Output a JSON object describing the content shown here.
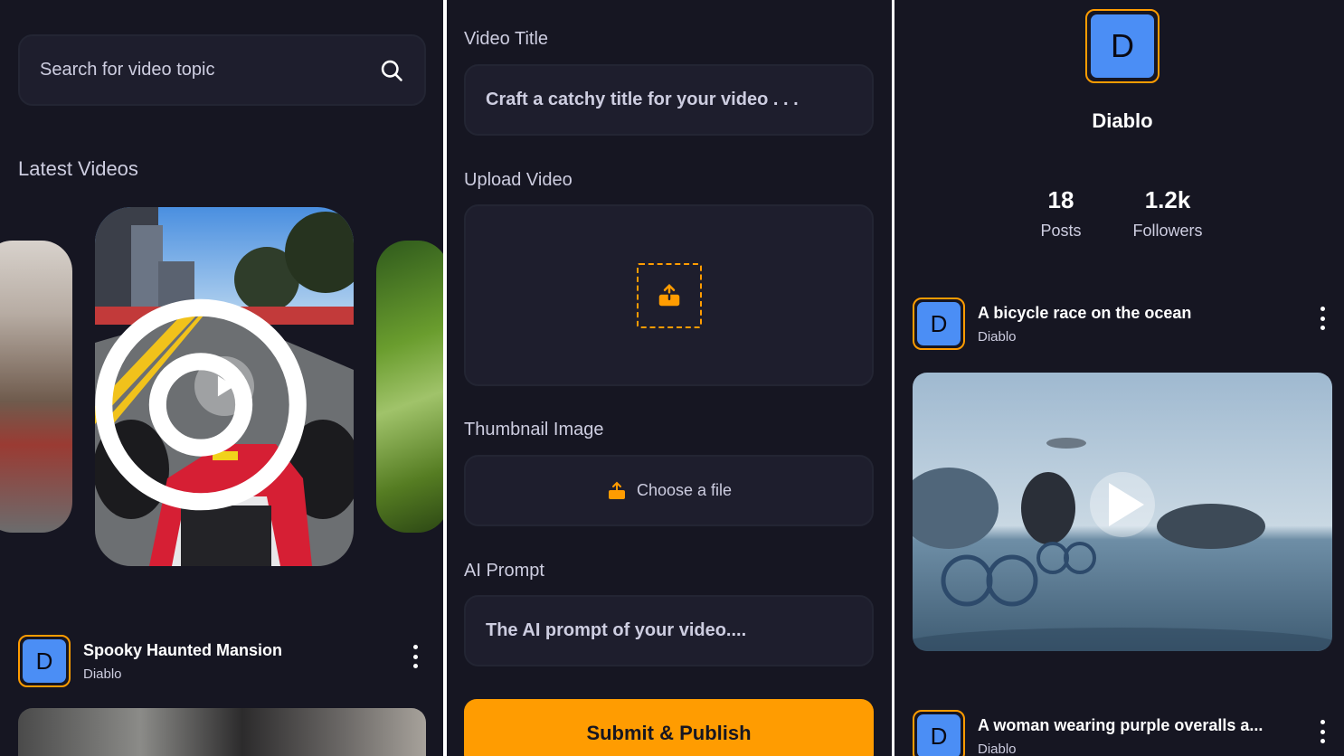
{
  "home": {
    "search": {
      "placeholder": "Search for video topic"
    },
    "latest_title": "Latest Videos",
    "post": {
      "avatar_letter": "D",
      "title": "Spooky Haunted Mansion",
      "creator": "Diablo"
    }
  },
  "create": {
    "video_title": {
      "label": "Video Title",
      "placeholder": "Craft a catchy title for your video . . ."
    },
    "upload_video": {
      "label": "Upload Video"
    },
    "thumbnail": {
      "label": "Thumbnail Image",
      "button": "Choose a file"
    },
    "ai_prompt": {
      "label": "AI Prompt",
      "placeholder": "The AI prompt of your video...."
    },
    "submit_label": "Submit & Publish"
  },
  "profile": {
    "avatar_letter": "D",
    "name": "Diablo",
    "stats": [
      {
        "value": "18",
        "label": "Posts"
      },
      {
        "value": "1.2k",
        "label": "Followers"
      }
    ],
    "posts": [
      {
        "avatar_letter": "D",
        "title": "A bicycle race on the ocean",
        "creator": "Diablo"
      },
      {
        "avatar_letter": "D",
        "title": "A woman wearing purple overalls a...",
        "creator": "Diablo"
      }
    ]
  },
  "colors": {
    "background": "#161622",
    "field": "#1e1e2d",
    "accent": "#ff9c01",
    "avatar": "#4b8ef5"
  }
}
